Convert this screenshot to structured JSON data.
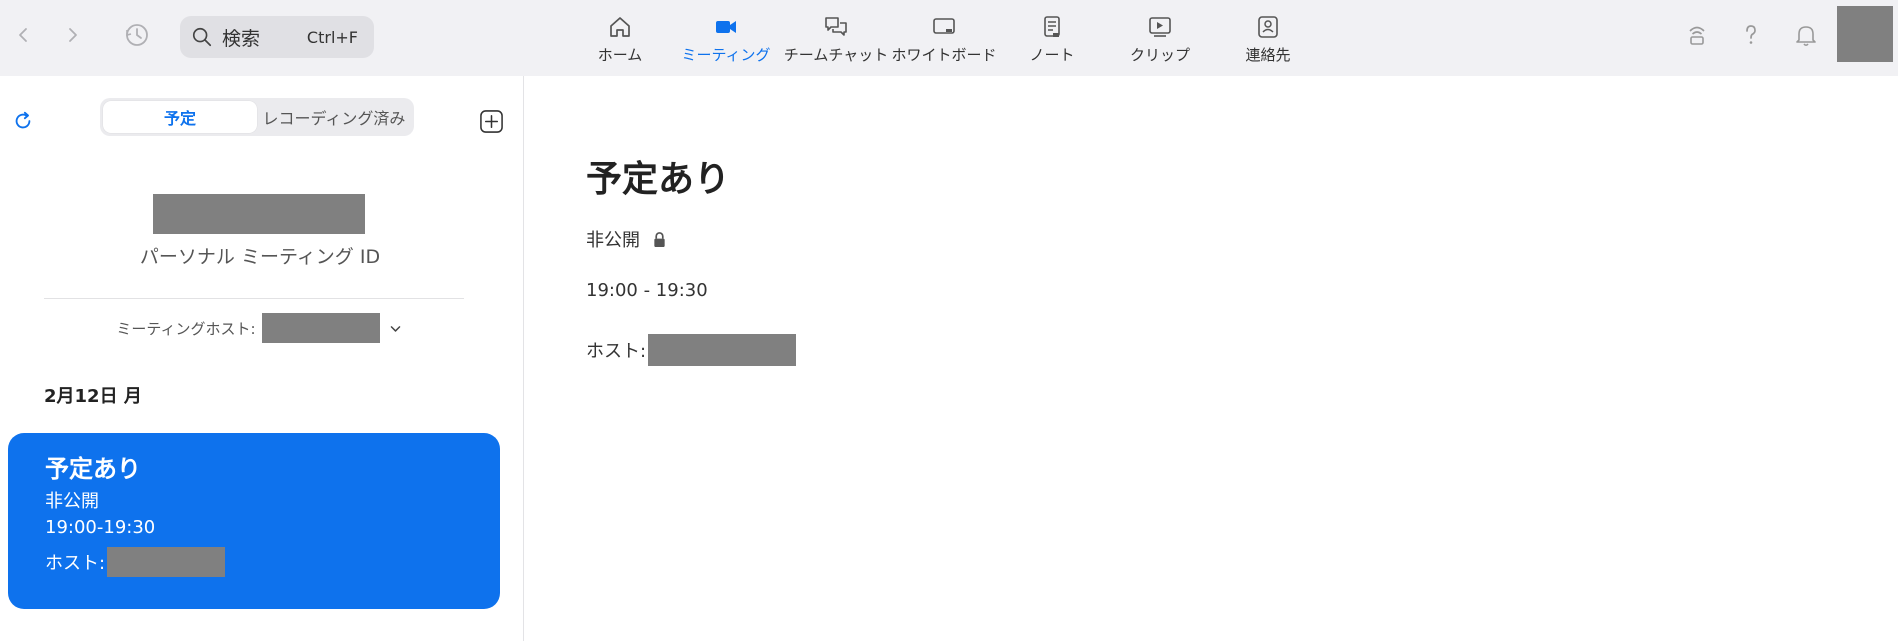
{
  "toolbar": {
    "back_icon": "chevron-left-icon",
    "forward_icon": "chevron-right-icon",
    "history_icon": "history-clock-icon",
    "search": {
      "label": "検索",
      "shortcut": "Ctrl+F"
    },
    "tabs": [
      {
        "label": "ホーム",
        "icon": "home-icon",
        "active": false
      },
      {
        "label": "ミーティング",
        "icon": "video-camera-icon",
        "active": true
      },
      {
        "label": "チームチャット",
        "icon": "chat-bubbles-icon",
        "active": false
      },
      {
        "label": "ホワイトボード",
        "icon": "whiteboard-icon",
        "active": false
      },
      {
        "label": "ノート",
        "icon": "notebook-icon",
        "active": false
      },
      {
        "label": "クリップ",
        "icon": "clip-play-icon",
        "active": false
      },
      {
        "label": "連絡先",
        "icon": "contact-card-icon",
        "active": false
      }
    ],
    "right_icons": [
      "wireless-share-icon",
      "help-question-icon",
      "bell-icon"
    ]
  },
  "sidebar": {
    "segments": [
      {
        "label": "予定",
        "active": true
      },
      {
        "label": "レコーディング済み",
        "active": false
      }
    ],
    "personal_meeting_id_label": "パーソナル ミーティング ID",
    "meeting_host_label": "ミーティングホスト:",
    "date_heading": "2月12日 月",
    "meeting_card": {
      "title": "予定あり",
      "privacy": "非公開",
      "time": "19:00-19:30",
      "host_label": "ホスト:"
    }
  },
  "detail": {
    "title": "予定あり",
    "privacy": "非公開",
    "time": "19:00 - 19:30",
    "host_label": "ホスト:"
  },
  "colors": {
    "accent": "#0e72ed",
    "topbar_bg": "#f1f1f4",
    "redaction": "#808080"
  }
}
